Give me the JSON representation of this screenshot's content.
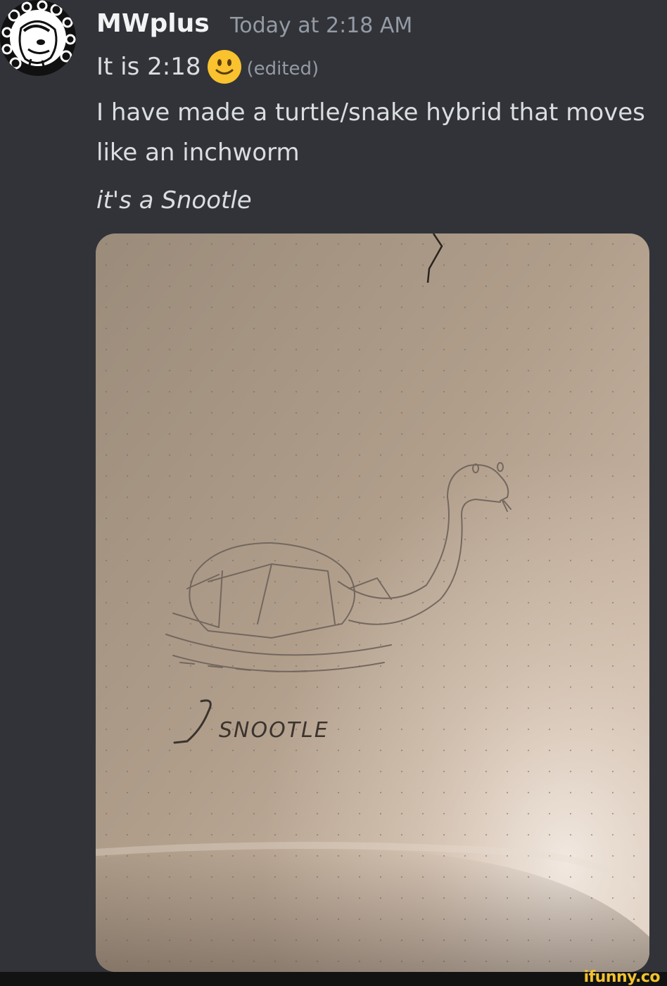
{
  "message": {
    "author": "MWplus",
    "timestamp": "Today at 2:18 AM",
    "line1": "It is 2:18",
    "emoji": "slightly-smiling-face-icon",
    "edited_label": "(edited)",
    "line2": "I have made a turtle/snake hybrid that moves",
    "line3": "like an inchworm",
    "line4": "it's a Snootle"
  },
  "attachment": {
    "handwritten_text": "SNOOTLE"
  },
  "watermark": "ifunny.co",
  "colors": {
    "background": "#313338",
    "username": "#f2f3f5",
    "text": "#dbdee1",
    "muted": "#949ba4",
    "emoji": "#f9c22e",
    "watermark": "#f2c230"
  }
}
